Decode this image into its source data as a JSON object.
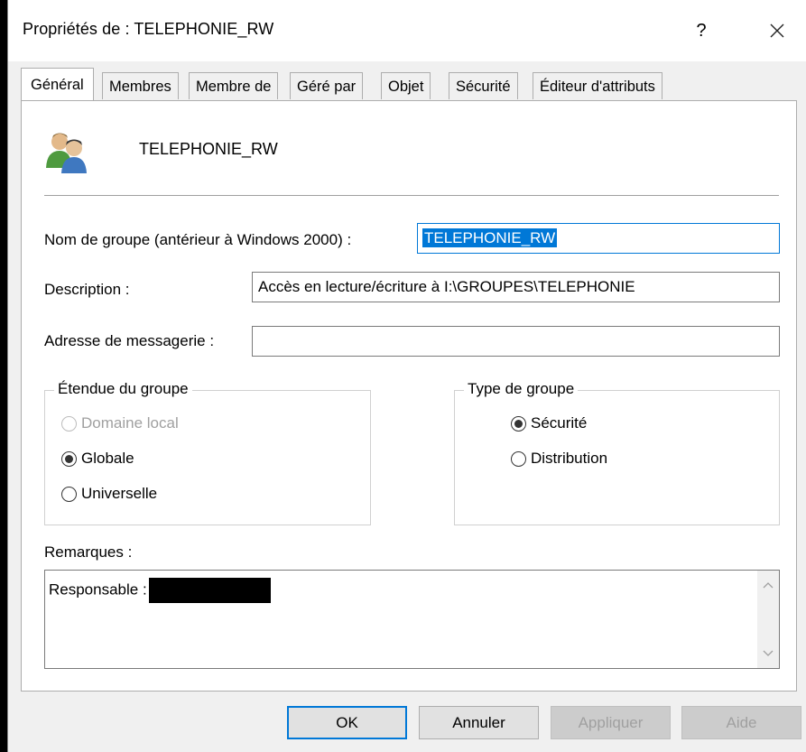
{
  "window": {
    "title": "Propriétés de : TELEPHONIE_RW",
    "help_label": "?"
  },
  "tabs": [
    {
      "label": "Général",
      "active": true
    },
    {
      "label": "Membres"
    },
    {
      "label": "Membre de"
    },
    {
      "label": "Géré par"
    },
    {
      "label": "Objet"
    },
    {
      "label": "Sécurité"
    },
    {
      "label": "Éditeur d'attributs"
    }
  ],
  "general": {
    "group_icon": "group-users-icon",
    "group_name": "TELEPHONIE_RW",
    "pre2000_label": "Nom de groupe (antérieur à Windows 2000) :",
    "pre2000_value": "TELEPHONIE_RW",
    "description_label": "Description :",
    "description_value": "Accès en lecture/écriture à I:\\GROUPES\\TELEPHONIE",
    "email_label": "Adresse de messagerie :",
    "email_value": "",
    "scope": {
      "title": "Étendue du groupe",
      "options": [
        {
          "label": "Domaine local",
          "checked": false,
          "disabled": true
        },
        {
          "label": "Globale",
          "checked": true,
          "disabled": false
        },
        {
          "label": "Universelle",
          "checked": false,
          "disabled": false
        }
      ]
    },
    "type": {
      "title": "Type de groupe",
      "options": [
        {
          "label": "Sécurité",
          "checked": true
        },
        {
          "label": "Distribution",
          "checked": false
        }
      ]
    },
    "notes_label": "Remarques :",
    "notes_value": "Responsable :"
  },
  "buttons": {
    "ok": "OK",
    "cancel": "Annuler",
    "apply": "Appliquer",
    "help": "Aide"
  },
  "colors": {
    "accent": "#0078d7",
    "disabled_text": "#a0a0a0"
  }
}
